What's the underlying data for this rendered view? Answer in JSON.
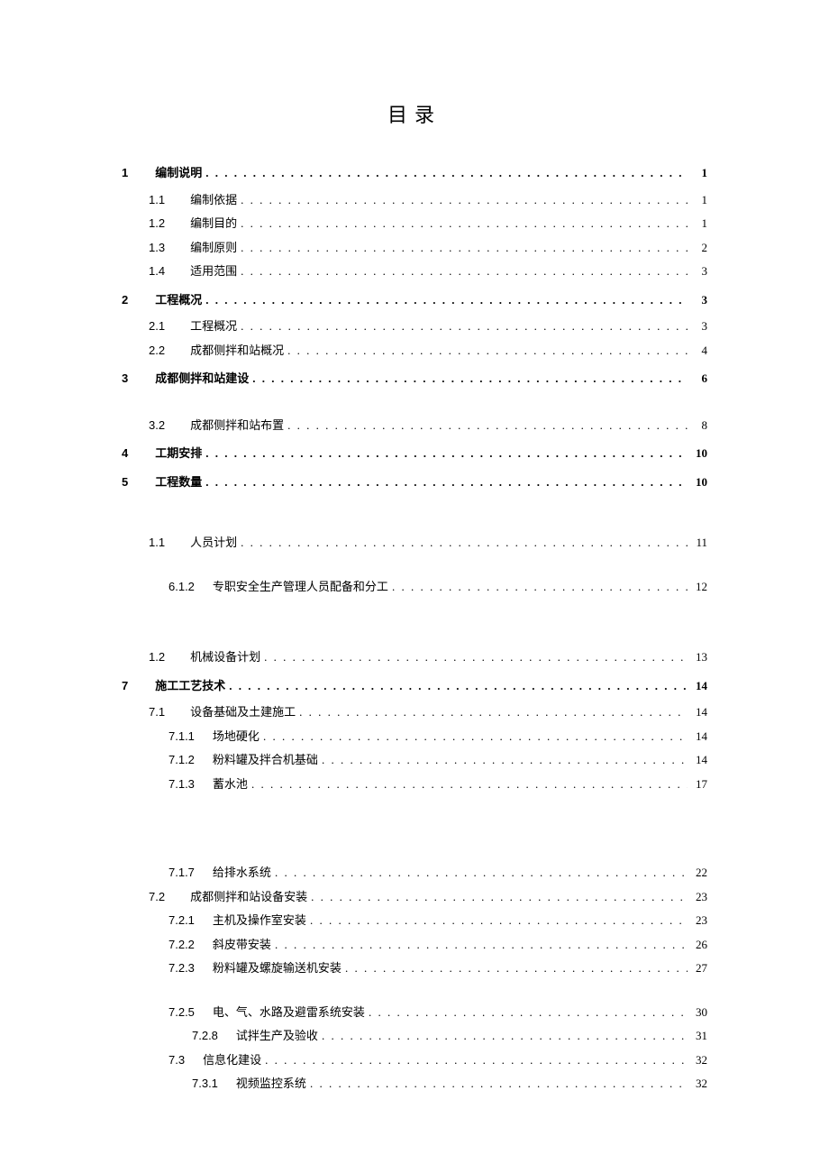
{
  "title": "目录",
  "entries": [
    {
      "level": 1,
      "num": "1",
      "label": "编制说明",
      "page": "1"
    },
    {
      "level": 2,
      "num": "1.1",
      "label": "编制依据",
      "page": "1"
    },
    {
      "level": 2,
      "num": "1.2",
      "label": "编制目的",
      "page": "1"
    },
    {
      "level": 2,
      "num": "1.3",
      "label": "编制原则",
      "page": "2"
    },
    {
      "level": 2,
      "num": "1.4",
      "label": "适用范围",
      "page": "3"
    },
    {
      "level": 1,
      "num": "2",
      "label": "工程概况",
      "page": "3"
    },
    {
      "level": 2,
      "num": "2.1",
      "label": "工程概况",
      "page": "3"
    },
    {
      "level": 2,
      "num": "2.2",
      "label": "成都侧拌和站概况",
      "page": "4"
    },
    {
      "level": 1,
      "num": "3",
      "label": "成都侧拌和站建设",
      "page": "6"
    },
    {
      "level": 0,
      "gap": "sm"
    },
    {
      "level": 2,
      "num": "3.2",
      "label": "成都侧拌和站布置",
      "page": "8"
    },
    {
      "level": 1,
      "num": "4",
      "label": "工期安排",
      "page": "10"
    },
    {
      "level": 1,
      "num": "5",
      "label": "工程数量",
      "page": "10"
    },
    {
      "level": 0,
      "gap": "md"
    },
    {
      "level": 2,
      "num": "1.1",
      "label": "人员计划",
      "page": "11"
    },
    {
      "level": 0,
      "gap": "sm"
    },
    {
      "level": 3,
      "num": "6.1.2",
      "label": "专职安全生产管理人员配备和分工",
      "page": "12"
    },
    {
      "level": 0,
      "gap": "lg"
    },
    {
      "level": 2,
      "num": "1.2",
      "label": "机械设备计划",
      "page": "13"
    },
    {
      "level": 1,
      "num": "7",
      "label": "施工工艺技术",
      "page": "14"
    },
    {
      "level": 2,
      "num": "7.1",
      "label": "设备基础及土建施工",
      "page": "14"
    },
    {
      "level": 3,
      "num": "7.1.1",
      "label": "场地硬化",
      "page": "14"
    },
    {
      "level": 3,
      "num": "7.1.2",
      "label": "粉料罐及拌合机基础",
      "page": "14"
    },
    {
      "level": 3,
      "num": "7.1.3",
      "label": "蓄水池",
      "page": "17"
    },
    {
      "level": 0,
      "gap": "xl"
    },
    {
      "level": 3,
      "num": "7.1.7",
      "label": "给排水系统",
      "page": "22"
    },
    {
      "level": 2,
      "num": "7.2",
      "label": "成都侧拌和站设备安装",
      "page": "23"
    },
    {
      "level": 3,
      "num": "7.2.1",
      "label": "主机及操作室安装",
      "page": "23"
    },
    {
      "level": 3,
      "num": "7.2.2",
      "label": "斜皮带安装",
      "page": "26"
    },
    {
      "level": 3,
      "num": "7.2.3",
      "label": "粉料罐及螺旋输送机安装",
      "page": "27"
    },
    {
      "level": 0,
      "gap": "sm"
    },
    {
      "level": 3,
      "num": "7.2.5",
      "label": "电、气、水路及避雷系统安装",
      "page": "30"
    },
    {
      "level": 4,
      "num": "7.2.8",
      "label": "试拌生产及验收",
      "page": "31"
    },
    {
      "level": 3,
      "num": "7.3",
      "label": "信息化建设",
      "page": "32"
    },
    {
      "level": 4,
      "num": "7.3.1",
      "label": "视频监控系统",
      "page": "32"
    }
  ]
}
